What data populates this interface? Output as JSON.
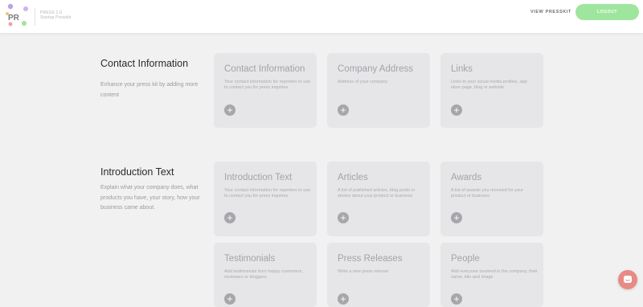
{
  "header": {
    "brand_line1": "PRESS 1.0",
    "brand_line2": "Startup Presskit",
    "view_presskit": "VIEW PRESSKIT",
    "logout": "LOGOUT"
  },
  "sections": [
    {
      "title": "Contact Information",
      "description": "Enhance your press kit by adding more content",
      "cards": [
        {
          "title": "Contact Information",
          "description": "Your contact information for reporters to use to contact you for press inquiries"
        },
        {
          "title": "Company Address",
          "description": "Address of your company"
        },
        {
          "title": "Links",
          "description": "Links to your social media profiles, app store page, blog or website"
        }
      ]
    },
    {
      "title": "Introduction Text",
      "description": "Explain what your company does, what products you have, your story, how your business came about.",
      "cards": [
        {
          "title": "Introduction Text",
          "description": "Your contact information for reporters to use to contact you for press inquiries"
        },
        {
          "title": "Articles",
          "description": "A list of published articles, blog posts or stories about your product or business"
        },
        {
          "title": "Awards",
          "description": "A list of awards you received for your product or business"
        },
        {
          "title": "Testimonials",
          "description": "Add testimonials from happy customers, reviewers or bloggers"
        },
        {
          "title": "Press Releases",
          "description": "Write a new press release"
        },
        {
          "title": "People",
          "description": "Add everyone involved in the company, their name, title and image"
        }
      ]
    }
  ],
  "add_symbol": "+",
  "colors": {
    "logout_bg": "#9ee69d",
    "card_bg": "#e6e6e9",
    "chat_bg": "#e88a86"
  }
}
